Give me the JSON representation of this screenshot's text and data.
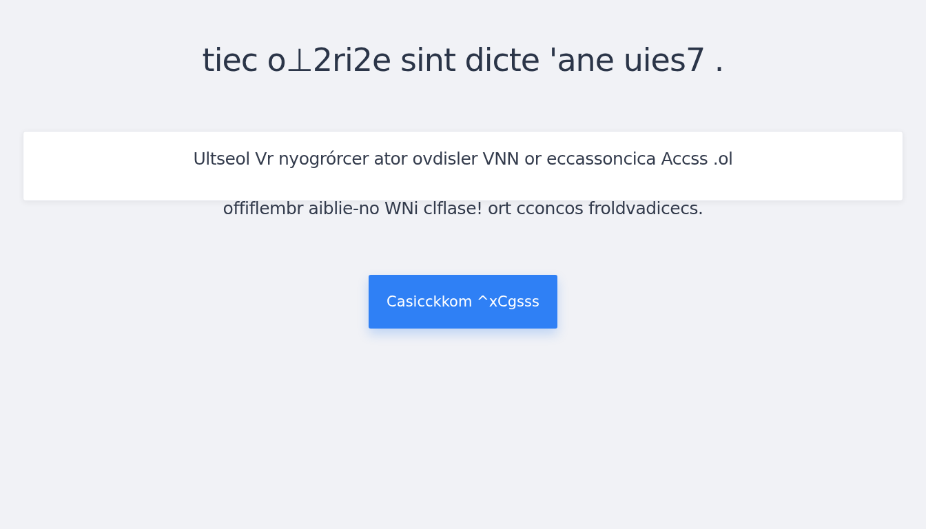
{
  "heading": "tiec o⊥2ri2e sint dicte 'ane uies7 .",
  "notice": {
    "text": "Ultseol Vr nyogrórcer ator ovdisler VNN or eccassoncica Accss .ol"
  },
  "description": "offiflembr aiblie-no WNi clflase! ort cconcos froldvadicecs.",
  "button": {
    "label": "Casicckkom ^xCgsss"
  }
}
